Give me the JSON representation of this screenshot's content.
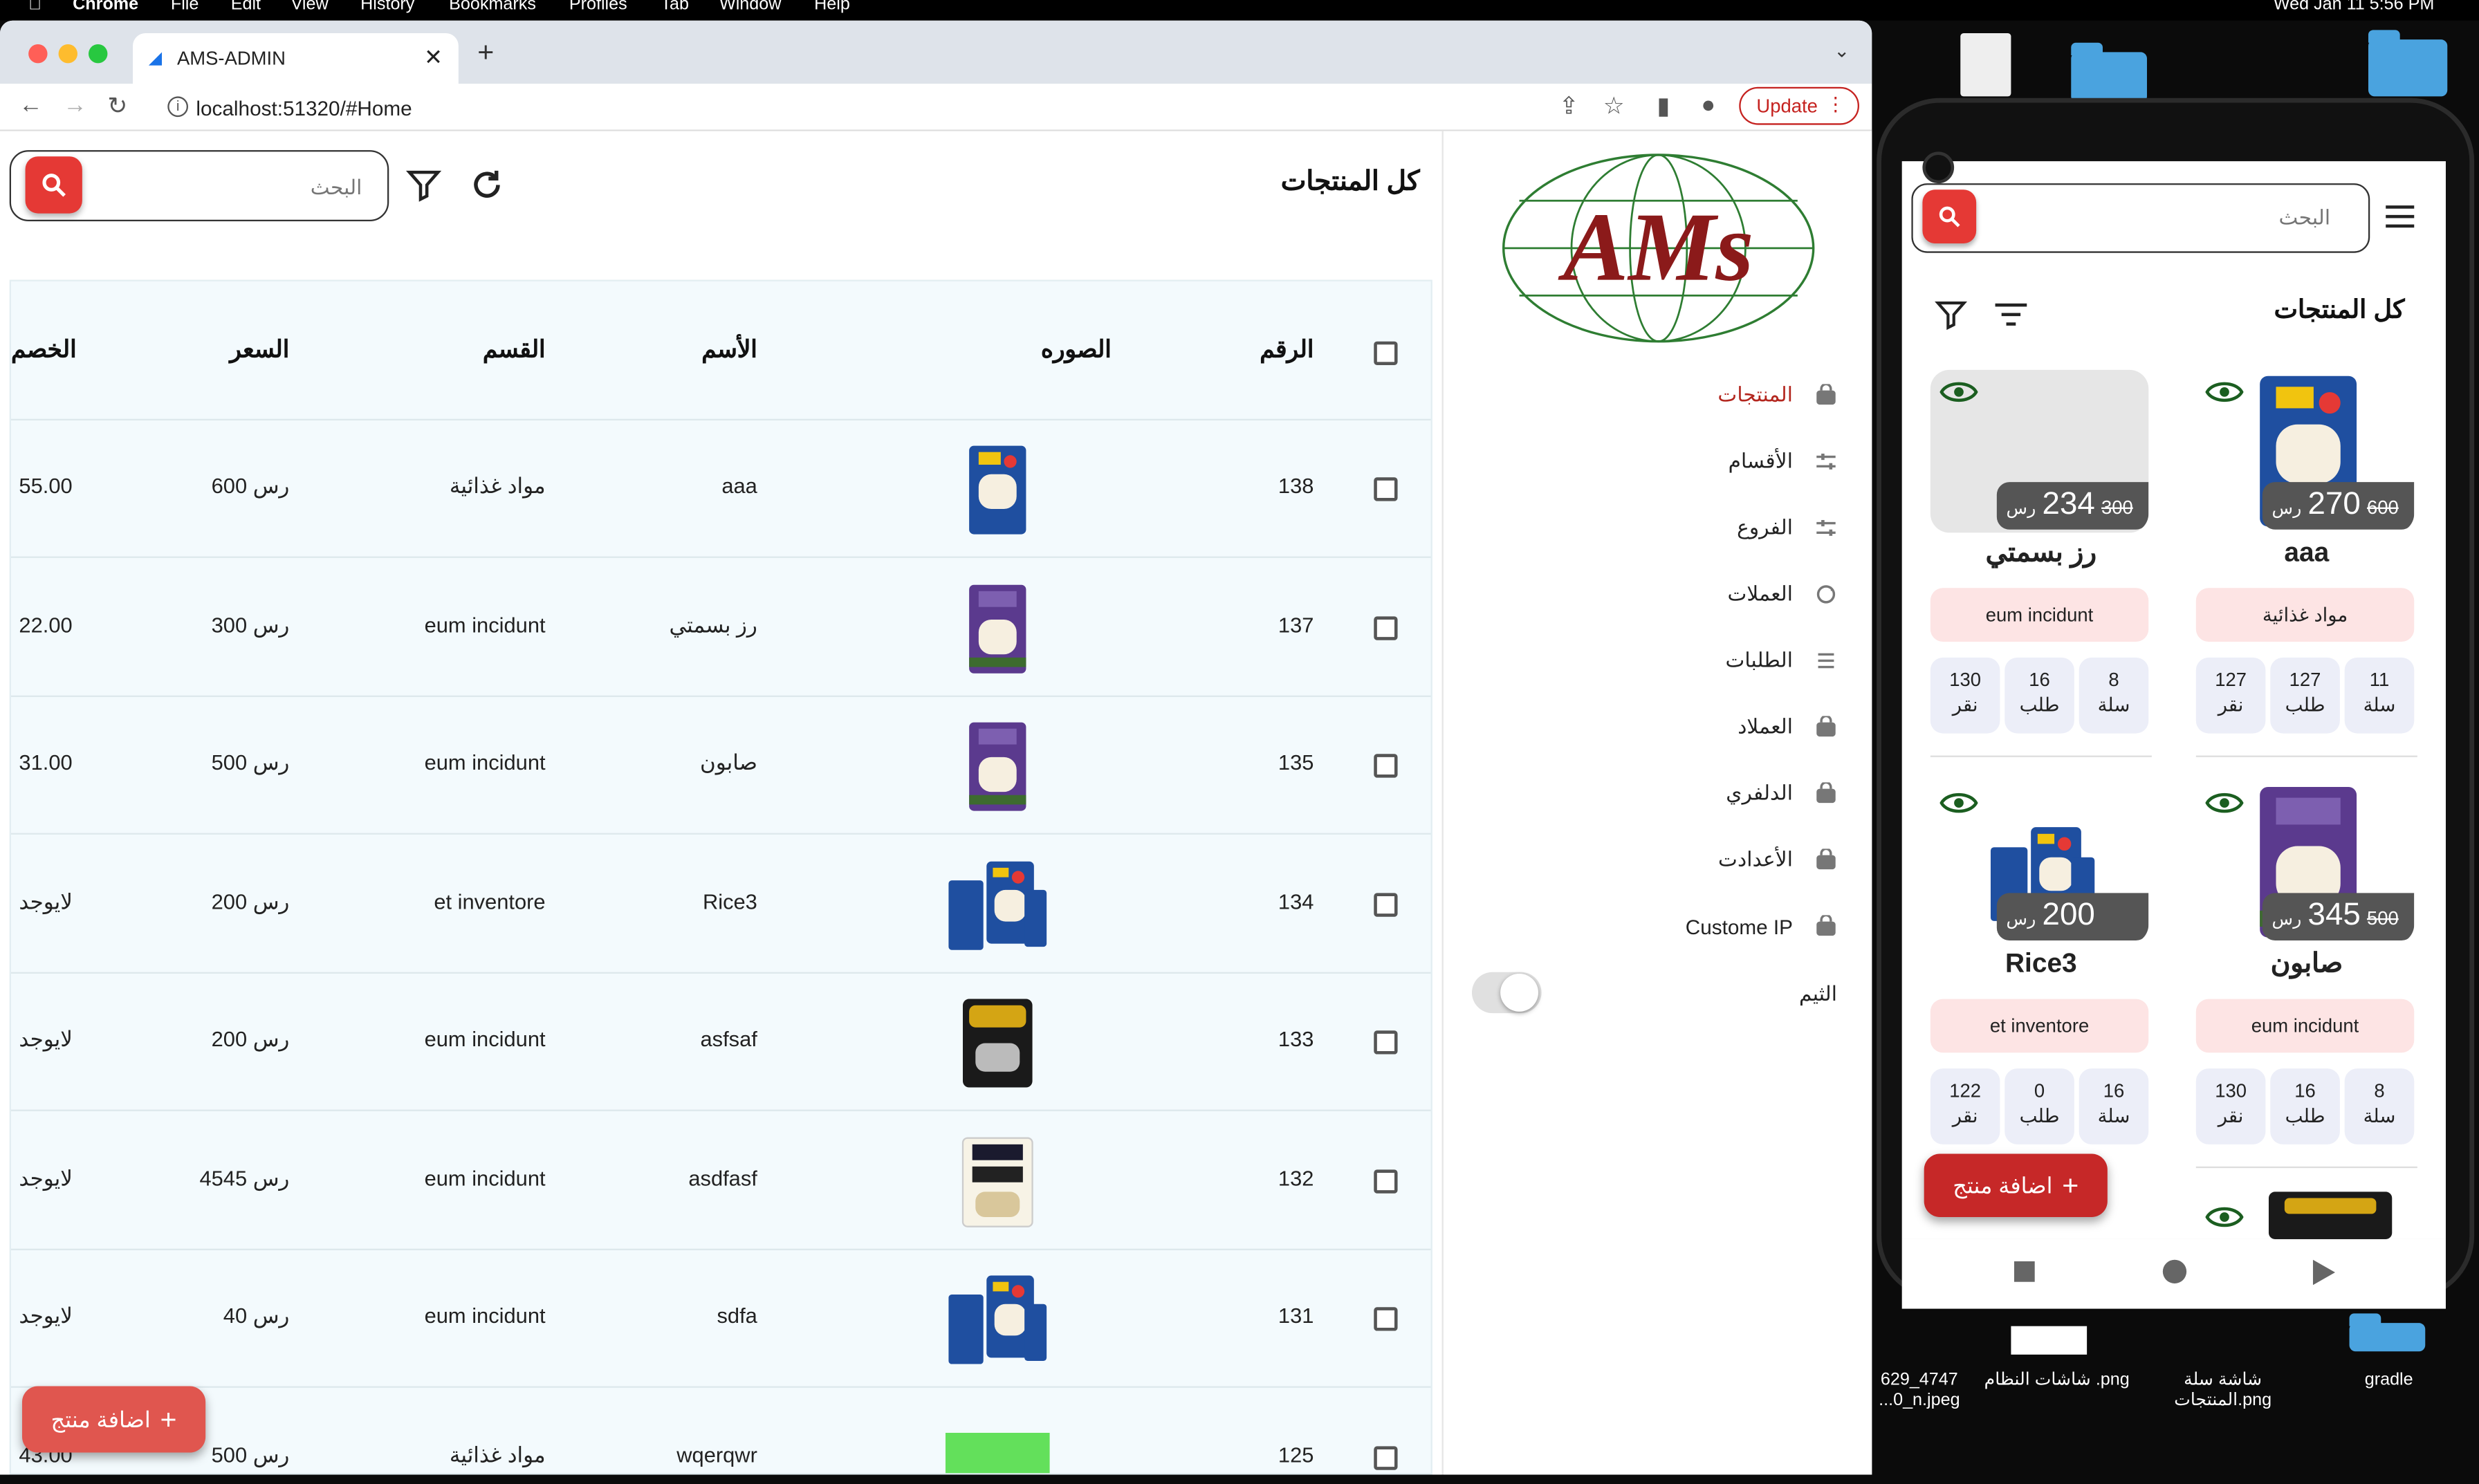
{
  "menubar": {
    "apple": "",
    "items": [
      "Chrome",
      "File",
      "Edit",
      "View",
      "History",
      "Bookmarks",
      "Profiles",
      "Tab",
      "Window",
      "Help"
    ],
    "clock": "Wed Jan 11  5:56 PM"
  },
  "browser": {
    "tab_title": "AMS-ADMIN",
    "url": "localhost:51320/#Home",
    "update_label": "Update"
  },
  "app": {
    "page_title": "كل المنتجات",
    "search_placeholder": "البحث",
    "sidebar": [
      {
        "label": "المنتجات",
        "icon": "bag-icon",
        "active": true
      },
      {
        "label": "الأقسام",
        "icon": "sliders-icon",
        "active": false
      },
      {
        "label": "الفروع",
        "icon": "sliders-icon",
        "active": false
      },
      {
        "label": "العملات",
        "icon": "sync-icon",
        "active": false
      },
      {
        "label": "الطلبات",
        "icon": "list-icon",
        "active": false
      },
      {
        "label": "العملاد",
        "icon": "bag-icon",
        "active": false
      },
      {
        "label": "الدلفري",
        "icon": "bag-icon",
        "active": false
      },
      {
        "label": "الأعدادت",
        "icon": "bag-icon",
        "active": false
      },
      {
        "label": "Custome IP",
        "icon": "bag-icon",
        "active": false
      }
    ],
    "theme_label": "الثيم",
    "columns": {
      "id": "الرقم",
      "image": "الصوره",
      "name": "الأسم",
      "category": "القسم",
      "price": "السعر",
      "discount": "الخصم"
    },
    "rows": [
      {
        "id": "138",
        "name": "aaa",
        "category": "مواد غذائية",
        "price": "600 رس",
        "discount": "55.00",
        "thumb": "rice-blue"
      },
      {
        "id": "137",
        "name": "رز بسمتي",
        "category": "eum incidunt",
        "price": "300 رس",
        "discount": "22.00",
        "thumb": "rice-purple"
      },
      {
        "id": "135",
        "name": "صابون",
        "category": "eum incidunt",
        "price": "500 رس",
        "discount": "31.00",
        "thumb": "rice-purple"
      },
      {
        "id": "134",
        "name": "Rice3",
        "category": "et inventore",
        "price": "200 رس",
        "discount": "لايوجد",
        "thumb": "rice-bags"
      },
      {
        "id": "133",
        "name": "asfsaf",
        "category": "eum incidunt",
        "price": "200 رس",
        "discount": "لايوجد",
        "thumb": "rice-black"
      },
      {
        "id": "132",
        "name": "asdfasf",
        "category": "eum incidunt",
        "price": "4545 رس",
        "discount": "لايوجد",
        "thumb": "rice-white"
      },
      {
        "id": "131",
        "name": "sdfa",
        "category": "eum incidunt",
        "price": "40 رس",
        "discount": "لايوجد",
        "thumb": "rice-bags"
      },
      {
        "id": "125",
        "name": "wqerqwr",
        "category": "مواد غذائية",
        "price": "500 رس",
        "discount": "43.00",
        "thumb": "green"
      }
    ],
    "add_label": "اضافة منتج"
  },
  "phone": {
    "search_placeholder": "البحث",
    "title": "كل المنتجات",
    "cards": [
      {
        "name": "aaa",
        "old": "600",
        "price": "270",
        "currency": "رس",
        "category": "مواد غذائية",
        "cart": "11",
        "orders": "127",
        "clicks": "127",
        "img": "rice-blue"
      },
      {
        "name": "رز بسمتي",
        "old": "300",
        "price": "234",
        "currency": "رس",
        "category": "eum incidunt",
        "cart": "8",
        "orders": "16",
        "clicks": "130",
        "img": "none"
      },
      {
        "name": "صابون",
        "old": "500",
        "price": "345",
        "currency": "رس",
        "category": "eum incidunt",
        "cart": "8",
        "orders": "16",
        "clicks": "130",
        "img": "rice-purple"
      },
      {
        "name": "Rice3",
        "old": "",
        "price": "200",
        "currency": "رس",
        "category": "et inventore",
        "cart": "16",
        "orders": "0",
        "clicks": "122",
        "img": "rice-bags"
      }
    ],
    "stat_labels": {
      "cart": "سلة",
      "orders": "طلب",
      "clicks": "نقر"
    },
    "add_label": "اضافة منتج"
  },
  "desktop": {
    "labels": [
      "629_4747\n...0_n.jpeg",
      "شاشات النظام .png",
      "شاشة سلة\nالمنتجات.png",
      "gradle"
    ]
  }
}
